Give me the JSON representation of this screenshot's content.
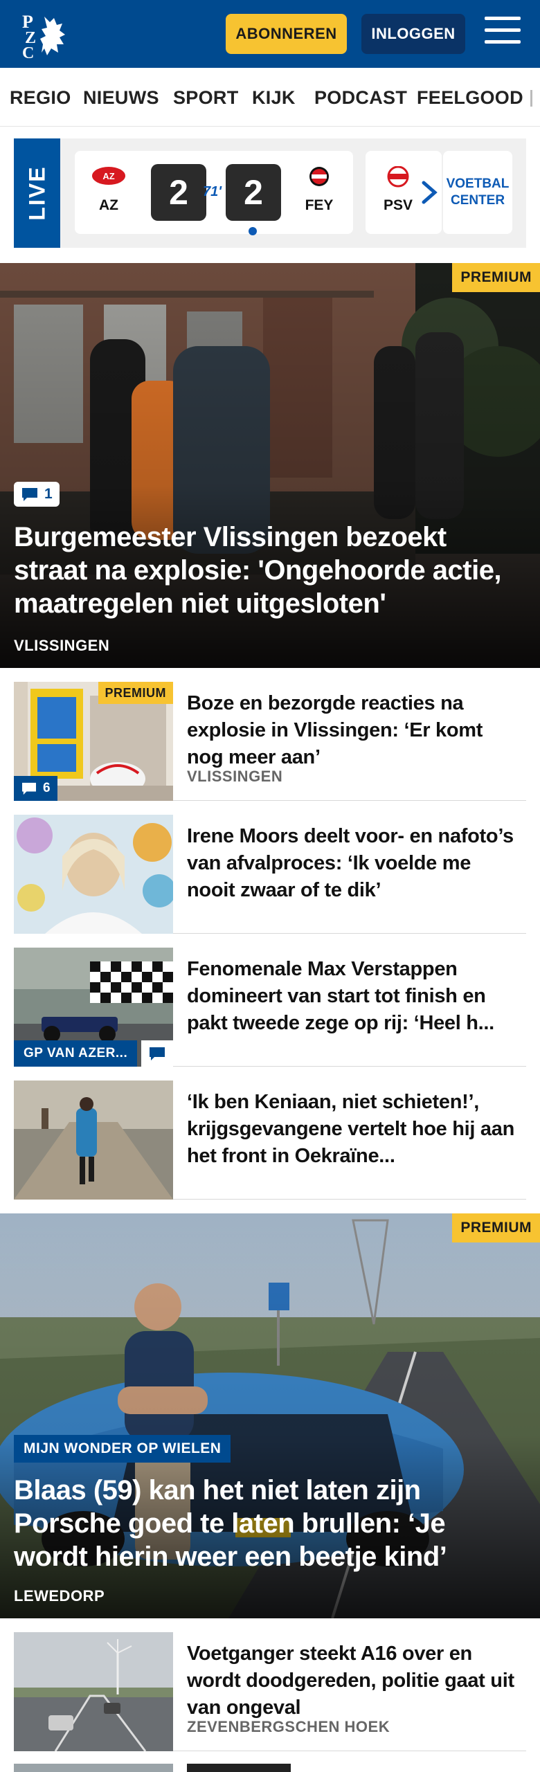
{
  "header": {
    "subscribe_label": "ABONNEREN",
    "login_label": "INLOGGEN",
    "logo_text": "PZC"
  },
  "nav": {
    "items": [
      "REGIO",
      "NIEUWS",
      "SPORT",
      "KIJK",
      "PODCAST",
      "FEELGOOD"
    ]
  },
  "live": {
    "tag": "LIVE",
    "match": {
      "home_team": "AZ",
      "away_team": "FEY",
      "home_score": "2",
      "away_score": "2",
      "minute": "71'"
    },
    "next_team": "PSV",
    "voetbal_center_line1": "VOETBAL",
    "voetbal_center_line2": "CENTER"
  },
  "hero1": {
    "premium_label": "PREMIUM",
    "comment_count": "1",
    "title": "Burgemeester Vlissingen bezoekt straat na explosie: 'Ongehoorde actie, maatregelen niet uitgesloten'",
    "location": "VLISSINGEN"
  },
  "articles": [
    {
      "title": "Boze en bezorgde reacties na explosie in Vlissingen: ‘Er komt nog meer aan’",
      "location": "VLISSINGEN",
      "premium_label": "PREMIUM",
      "comment_count": "6"
    },
    {
      "title": "Irene Moors deelt voor- en nafoto’s van afvalproces: ‘Ik voelde me nooit zwaar of te dik’"
    },
    {
      "title": "Fenomenale Max Verstappen domineert van start tot finish en pakt tweede zege op rij: ‘Heel h...",
      "category": "GP VAN AZER..."
    },
    {
      "title": "‘Ik ben Keniaan, niet schieten!’, krijgsgevangene vertelt hoe hij aan het front in Oekraïne..."
    }
  ],
  "hero2": {
    "premium_label": "PREMIUM",
    "category": "MIJN WONDER OP WIELEN",
    "title": "Blaas (59) kan het niet laten zijn Porsche goed te laten brullen: ‘Je wordt hierin weer een beetje kind’",
    "location": "LEWEDORP"
  },
  "article_last": {
    "title": "Voetganger steekt A16 over en wordt doodgereden, politie gaat uit van ongeval",
    "location": "ZEVENBERGSCHEN HOEK"
  },
  "colors": {
    "brand_blue": "#004a8f",
    "premium_yellow": "#f7c331",
    "link_blue": "#0d5ab5"
  }
}
